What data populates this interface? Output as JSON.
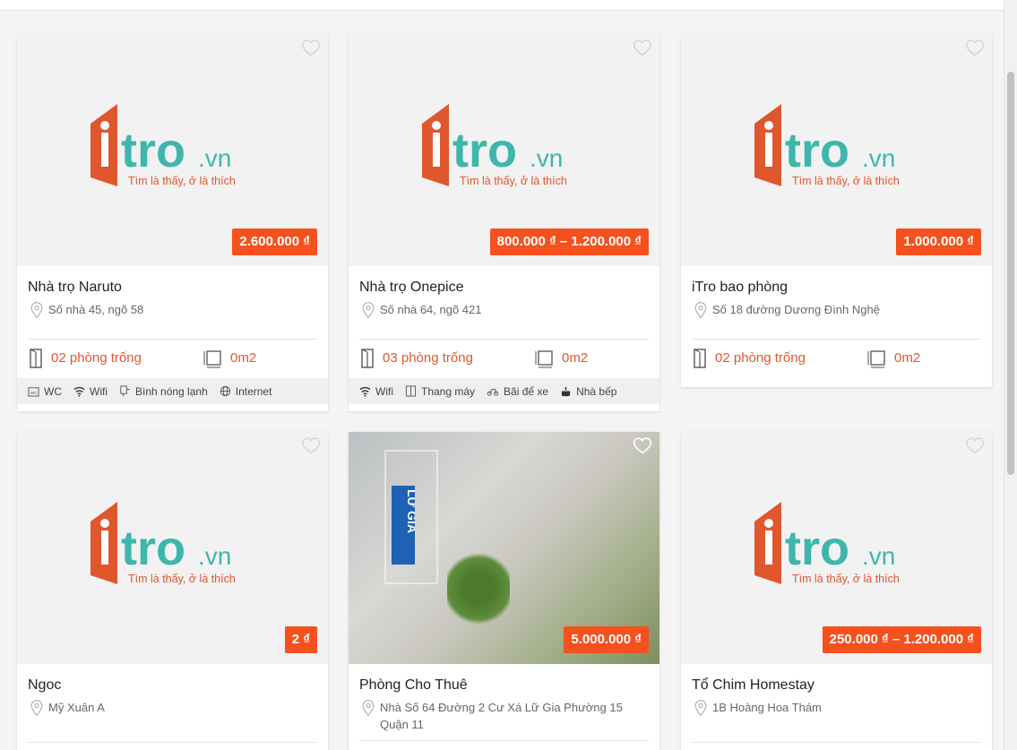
{
  "listings": [
    {
      "title": "Nhà trọ Naruto",
      "address": "Số nhà 45, ngõ 58",
      "price": "2.600.000 ₫",
      "rooms": "02 phòng trống",
      "area": "0m2",
      "amenities": [
        {
          "icon": "wc-icon",
          "label": "WC"
        },
        {
          "icon": "wifi-icon",
          "label": "Wifi"
        },
        {
          "icon": "water-heater-icon",
          "label": "Bình nóng lạnh"
        },
        {
          "icon": "internet-icon",
          "label": "Internet"
        }
      ]
    },
    {
      "title": "Nhà trọ Onepice",
      "address": "Số nhà 64, ngõ 421",
      "price": "800.000 ₫ – 1.200.000 ₫",
      "rooms": "03 phòng trống",
      "area": "0m2",
      "amenities": [
        {
          "icon": "wifi-icon",
          "label": "Wifi"
        },
        {
          "icon": "elevator-icon",
          "label": "Thang máy"
        },
        {
          "icon": "parking-icon",
          "label": "Bãi để xe"
        },
        {
          "icon": "kitchen-icon",
          "label": "Nhà bếp"
        }
      ]
    },
    {
      "title": "iTro bao phòng",
      "address": "Số 18 đường Dương Đình Nghệ",
      "price": "1.000.000 ₫",
      "rooms": "02 phòng trống",
      "area": "0m2",
      "amenities": []
    },
    {
      "title": "Ngoc",
      "address": "Mỹ Xuân A",
      "price": "2 ₫"
    },
    {
      "title": "Phòng Cho Thuê",
      "address": "Nhà Số 64 Đường 2 Cư Xá Lữ Gia Phường 15 Quận 11",
      "price": "5.000.000 ₫"
    },
    {
      "title": "Tổ Chim Homestay",
      "address": "1B Hoàng Hoa Thám",
      "price": "250.000 ₫ – 1.200.000 ₫"
    }
  ],
  "logo": {
    "text_i": "i",
    "text_tro": "tro",
    "text_vn": ".vn",
    "tagline": "Tìm là thấy, ở là thích"
  },
  "photo_sign": "LỮ GIA",
  "colors": {
    "accent": "#f4511e",
    "logo_orange": "#e0562d",
    "logo_teal": "#3fb6ac"
  }
}
